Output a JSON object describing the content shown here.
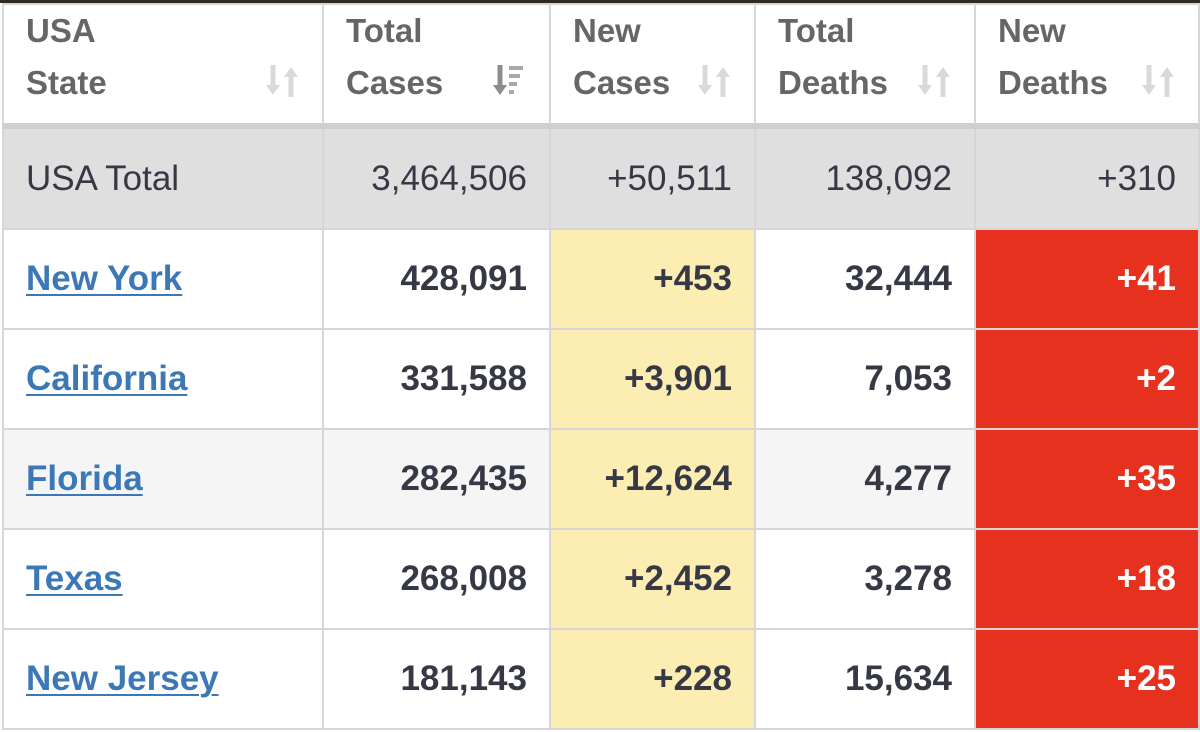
{
  "table": {
    "headers": [
      {
        "line1": "USA",
        "line2": "State",
        "sort_icon": "sort-updown-icon",
        "sort_state": "none"
      },
      {
        "line1": "Total",
        "line2": "Cases",
        "sort_icon": "sort-descending-icon",
        "sort_state": "descending"
      },
      {
        "line1": "New",
        "line2": "Cases",
        "sort_icon": "sort-updown-icon",
        "sort_state": "none"
      },
      {
        "line1": "Total",
        "line2": "Deaths",
        "sort_icon": "sort-updown-icon",
        "sort_state": "none"
      },
      {
        "line1": "New",
        "line2": "Deaths",
        "sort_icon": "sort-updown-icon",
        "sort_state": "none"
      }
    ],
    "total_row": {
      "name": "USA Total",
      "total_cases": "3,464,506",
      "new_cases": "+50,511",
      "total_deaths": "138,092",
      "new_deaths": "+310"
    },
    "rows": [
      {
        "state": "New York",
        "total_cases": "428,091",
        "new_cases": "+453",
        "total_deaths": "32,444",
        "new_deaths": "+41"
      },
      {
        "state": "California",
        "total_cases": "331,588",
        "new_cases": "+3,901",
        "total_deaths": "7,053",
        "new_deaths": "+2"
      },
      {
        "state": "Florida",
        "total_cases": "282,435",
        "new_cases": "+12,624",
        "total_deaths": "4,277",
        "new_deaths": "+35"
      },
      {
        "state": "Texas",
        "total_cases": "268,008",
        "new_cases": "+2,452",
        "total_deaths": "3,278",
        "new_deaths": "+18"
      },
      {
        "state": "New Jersey",
        "total_cases": "181,143",
        "new_cases": "+228",
        "total_deaths": "15,634",
        "new_deaths": "+25"
      }
    ]
  },
  "colors": {
    "new_cases_highlight": "#fceeb3",
    "new_deaths_highlight": "#e7311f",
    "link": "#3b78b5",
    "total_row_bg": "#dfdfdf",
    "alt_row_bg": "#f5f5f5"
  }
}
